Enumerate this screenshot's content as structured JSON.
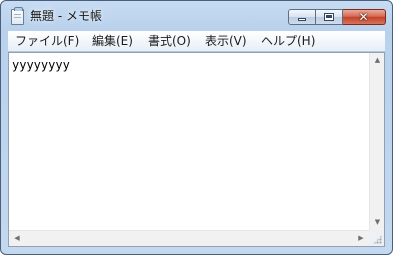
{
  "window": {
    "title": "無題 - メモ帳",
    "controls": {
      "minimize_icon": "minimize-icon",
      "maximize_icon": "maximize-icon",
      "close_symbol": "✕"
    }
  },
  "menu": {
    "items": [
      {
        "label": "ファイル(F)"
      },
      {
        "label": "編集(E)"
      },
      {
        "label": "書式(O)"
      },
      {
        "label": "表示(V)"
      },
      {
        "label": "ヘルプ(H)"
      }
    ]
  },
  "editor": {
    "content": "yyyyyyyy"
  },
  "scrollbars": {
    "up": "▲",
    "down": "▼",
    "left": "◀",
    "right": "▶"
  },
  "colors": {
    "frame": "#c4d8ef",
    "close_button": "#c4422a",
    "editor_bg": "#ffffff"
  }
}
